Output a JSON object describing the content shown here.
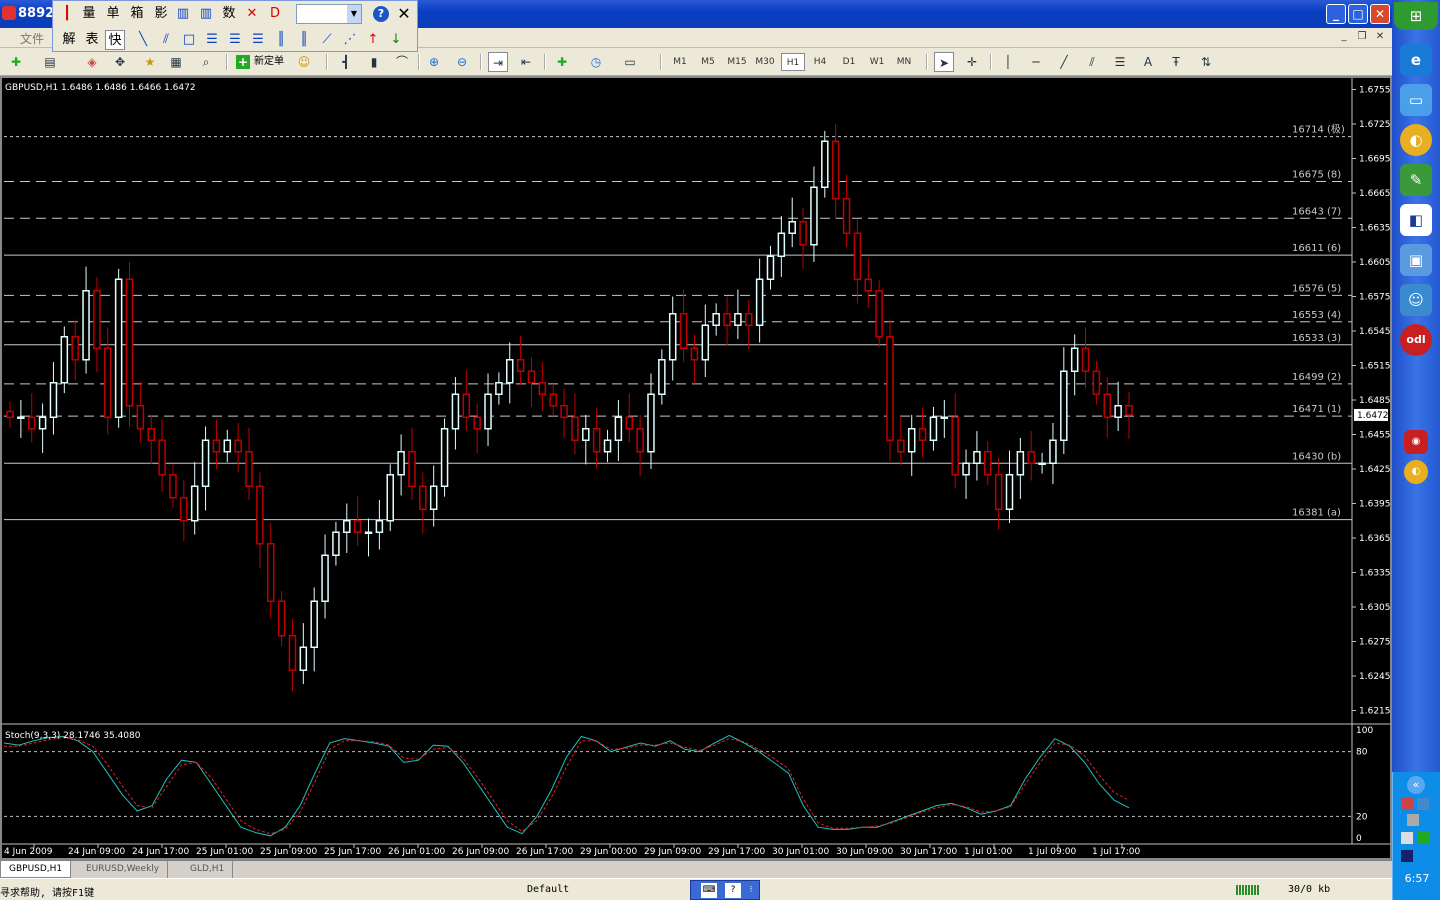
{
  "window": {
    "title": "8892",
    "minimize": "_",
    "maximize": "□",
    "close": "✕"
  },
  "menubar": {
    "file": "文件"
  },
  "float_toolbar": {
    "row1": [
      "量",
      "单",
      "箱",
      "影",
      "数"
    ],
    "row2": [
      "解",
      "表",
      "快"
    ]
  },
  "toolbar": {
    "new_order": "新定单",
    "timeframes": [
      "M1",
      "M5",
      "M15",
      "M30",
      "H1",
      "H4",
      "D1",
      "W1",
      "MN"
    ],
    "active_timeframe": "H1",
    "text_tool": "A"
  },
  "chart": {
    "symbol_info": "GBPUSD,H1  1.6486 1.6486 1.6466 1.6472",
    "price_axis": [
      "1.6755",
      "1.6725",
      "1.6695",
      "1.6665",
      "1.6635",
      "1.6605",
      "1.6575",
      "1.6545",
      "1.6515",
      "1.6485",
      "1.6455",
      "1.6425",
      "1.6395",
      "1.6365",
      "1.6335",
      "1.6305",
      "1.6275",
      "1.6245",
      "1.6215"
    ],
    "current_price": "1.6472",
    "levels": [
      {
        "price": 1.6714,
        "label": "16714 (极)",
        "style": "dash"
      },
      {
        "price": 1.6675,
        "label": "16675 (8)",
        "style": "longdash"
      },
      {
        "price": 1.6643,
        "label": "16643 (7)",
        "style": "longdash"
      },
      {
        "price": 1.6611,
        "label": "16611 (6)",
        "style": "solid"
      },
      {
        "price": 1.6576,
        "label": "16576 (5)",
        "style": "longdash"
      },
      {
        "price": 1.6553,
        "label": "16553 (4)",
        "style": "longdash"
      },
      {
        "price": 1.6533,
        "label": "16533 (3)",
        "style": "solid"
      },
      {
        "price": 1.6499,
        "label": "16499 (2)",
        "style": "longdash"
      },
      {
        "price": 1.6471,
        "label": "16471 (1)",
        "style": "longdash"
      },
      {
        "price": 1.643,
        "label": "16430 (b)",
        "style": "solid"
      },
      {
        "price": 1.6381,
        "label": "16381 (a)",
        "style": "solid"
      }
    ],
    "time_axis": [
      "4 Jun 2009",
      "24 Jun 09:00",
      "24 Jun 17:00",
      "25 Jun 01:00",
      "25 Jun 09:00",
      "25 Jun 17:00",
      "26 Jun 01:00",
      "26 Jun 09:00",
      "26 Jun 17:00",
      "29 Jun 00:00",
      "29 Jun 09:00",
      "29 Jun 17:00",
      "30 Jun 01:00",
      "30 Jun 09:00",
      "30 Jun 17:00",
      "1 Jul 01:00",
      "1 Jul 09:00",
      "1 Jul 17:00"
    ],
    "stoch_label": "Stoch(9,3,3) 28.1746 35.4080",
    "stoch_axis": [
      "100",
      "80",
      "20",
      "0"
    ]
  },
  "chart_data": {
    "type": "candlestick",
    "symbol": "GBPUSD",
    "timeframe": "H1",
    "ylim": [
      1.6205,
      1.6765
    ],
    "note_close_approx": [
      1.647,
      1.647,
      1.646,
      1.647,
      1.65,
      1.654,
      1.652,
      1.658,
      1.653,
      1.647,
      1.659,
      1.648,
      1.646,
      1.645,
      1.642,
      1.64,
      1.638,
      1.641,
      1.645,
      1.644,
      1.645,
      1.644,
      1.641,
      1.636,
      1.631,
      1.628,
      1.625,
      1.627,
      1.631,
      1.635,
      1.637,
      1.638,
      1.637,
      1.637,
      1.638,
      1.642,
      1.644,
      1.641,
      1.639,
      1.641,
      1.646,
      1.649,
      1.647,
      1.646,
      1.649,
      1.65,
      1.652,
      1.651,
      1.65,
      1.649,
      1.648,
      1.647,
      1.645,
      1.646,
      1.644,
      1.645,
      1.647,
      1.646,
      1.644,
      1.649,
      1.652,
      1.656,
      1.653,
      1.652,
      1.655,
      1.656,
      1.655,
      1.656,
      1.655,
      1.659,
      1.661,
      1.663,
      1.664,
      1.662,
      1.667,
      1.671,
      1.666,
      1.663,
      1.659,
      1.658,
      1.654,
      1.645,
      1.644,
      1.646,
      1.645,
      1.647,
      1.647,
      1.642,
      1.643,
      1.644,
      1.642,
      1.639,
      1.642,
      1.644,
      1.643,
      1.643,
      1.645,
      1.651,
      1.653,
      1.651,
      1.649,
      1.647,
      1.648,
      1.6472
    ],
    "series": [
      {
        "name": "Stoch main",
        "color": "#20c0c0"
      },
      {
        "name": "Stoch signal",
        "color": "#e02020"
      }
    ],
    "stoch_main": [
      88,
      86,
      90,
      93,
      94,
      90,
      80,
      60,
      40,
      25,
      30,
      55,
      72,
      70,
      50,
      30,
      10,
      5,
      2,
      10,
      30,
      60,
      88,
      92,
      90,
      88,
      85,
      70,
      72,
      86,
      85,
      70,
      50,
      30,
      10,
      4,
      20,
      45,
      75,
      94,
      90,
      80,
      84,
      88,
      85,
      90,
      82,
      80,
      88,
      95,
      88,
      80,
      70,
      60,
      30,
      10,
      8,
      8,
      10,
      10,
      15,
      20,
      25,
      30,
      32,
      28,
      22,
      25,
      30,
      55,
      75,
      92,
      85,
      70,
      50,
      35,
      28
    ],
    "stoch_signal": [
      85,
      85,
      88,
      91,
      93,
      91,
      85,
      68,
      48,
      30,
      28,
      48,
      68,
      70,
      56,
      36,
      16,
      8,
      4,
      8,
      24,
      52,
      82,
      90,
      90,
      89,
      86,
      74,
      73,
      82,
      84,
      74,
      56,
      36,
      16,
      6,
      16,
      38,
      66,
      90,
      90,
      82,
      83,
      86,
      86,
      88,
      84,
      81,
      86,
      92,
      89,
      82,
      74,
      64,
      36,
      14,
      9,
      9,
      10,
      11,
      14,
      19,
      24,
      28,
      31,
      29,
      24,
      25,
      29,
      50,
      70,
      88,
      86,
      76,
      58,
      42,
      35
    ]
  },
  "tabs": [
    "GBPUSD,H1",
    "EURUSD,Weekly",
    "GLD,H1"
  ],
  "statusbar": {
    "help": "寻求帮助, 请按F1键",
    "profile": "Default",
    "traffic": "30/0 kb"
  },
  "taskbar": {
    "clock": "6:57"
  }
}
